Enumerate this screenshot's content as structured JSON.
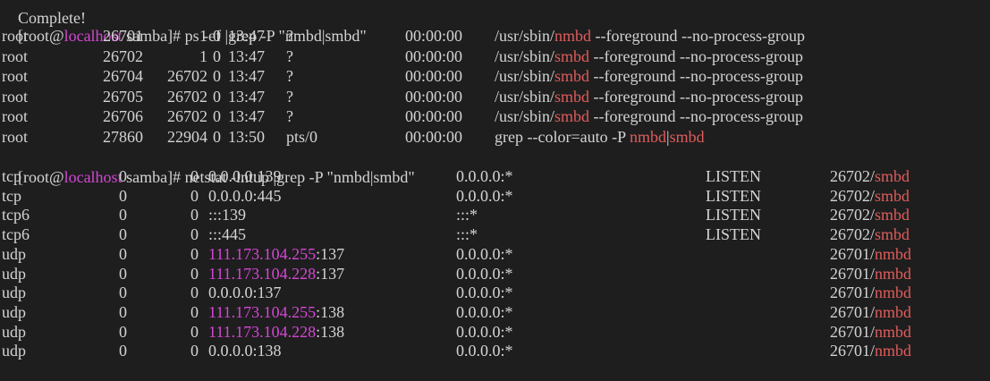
{
  "top_partial": "Complete!",
  "prompt": {
    "bracket_open": "[",
    "user": "root",
    "at": "@",
    "host": "localhost",
    "dir": " samba",
    "bracket_close": "]# "
  },
  "cmd1": {
    "pre": "ps -ef |grep -P \"nmbd|smbd\""
  },
  "ps_rows": [
    {
      "user": "root",
      "pid": "26701",
      "ppid": "1",
      "c": "0",
      "stime": "13:47",
      "tty": "?",
      "time": "00:00:00",
      "cmd_pre": "/usr/sbin/",
      "cmd_hl": "nmbd",
      "cmd_post": " --foreground --no-process-group"
    },
    {
      "user": "root",
      "pid": "26702",
      "ppid": "1",
      "c": "0",
      "stime": "13:47",
      "tty": "?",
      "time": "00:00:00",
      "cmd_pre": "/usr/sbin/",
      "cmd_hl": "smbd",
      "cmd_post": " --foreground --no-process-group"
    },
    {
      "user": "root",
      "pid": "26704",
      "ppid": "26702",
      "c": "0",
      "stime": "13:47",
      "tty": "?",
      "time": "00:00:00",
      "cmd_pre": "/usr/sbin/",
      "cmd_hl": "smbd",
      "cmd_post": " --foreground --no-process-group"
    },
    {
      "user": "root",
      "pid": "26705",
      "ppid": "26702",
      "c": "0",
      "stime": "13:47",
      "tty": "?",
      "time": "00:00:00",
      "cmd_pre": "/usr/sbin/",
      "cmd_hl": "smbd",
      "cmd_post": " --foreground --no-process-group"
    },
    {
      "user": "root",
      "pid": "26706",
      "ppid": "26702",
      "c": "0",
      "stime": "13:47",
      "tty": "?",
      "time": "00:00:00",
      "cmd_pre": "/usr/sbin/",
      "cmd_hl": "smbd",
      "cmd_post": " --foreground --no-process-group"
    },
    {
      "user": "root",
      "pid": "27860",
      "ppid": "22904",
      "c": "0",
      "stime": "13:50",
      "tty": "pts/0",
      "time": "00:00:00",
      "cmd_pre": "grep --color=auto -P ",
      "cmd_hl": "nmbd",
      "cmd_mid": "|",
      "cmd_hl2": "smbd",
      "cmd_post": ""
    }
  ],
  "cmd2": {
    "pre": "netstat -lntup |grep -P \"nmbd|smbd\""
  },
  "netstat_rows": [
    {
      "proto": "tcp",
      "recvq": "0",
      "sendq": "0",
      "local_pre": "0.0.0.0:139",
      "local_hl": "",
      "local_post": "",
      "foreign": "0.0.0.0:*",
      "state": "LISTEN",
      "pid": "26702/",
      "prog": "smbd"
    },
    {
      "proto": "tcp",
      "recvq": "0",
      "sendq": "0",
      "local_pre": "0.0.0.0:445",
      "local_hl": "",
      "local_post": "",
      "foreign": "0.0.0.0:*",
      "state": "LISTEN",
      "pid": "26702/",
      "prog": "smbd"
    },
    {
      "proto": "tcp6",
      "recvq": "0",
      "sendq": "0",
      "local_pre": ":::139",
      "local_hl": "",
      "local_post": "",
      "foreign": ":::*",
      "state": "LISTEN",
      "pid": "26702/",
      "prog": "smbd"
    },
    {
      "proto": "tcp6",
      "recvq": "0",
      "sendq": "0",
      "local_pre": ":::445",
      "local_hl": "",
      "local_post": "",
      "foreign": ":::*",
      "state": "LISTEN",
      "pid": "26702/",
      "prog": "smbd"
    },
    {
      "proto": "udp",
      "recvq": "0",
      "sendq": "0",
      "local_pre": "",
      "local_hl": "111.173.104.255",
      "local_post": ":137",
      "foreign": "0.0.0.0:*",
      "state": "",
      "pid": "26701/",
      "prog": "nmbd"
    },
    {
      "proto": "udp",
      "recvq": "0",
      "sendq": "0",
      "local_pre": "",
      "local_hl": "111.173.104.228",
      "local_post": ":137",
      "foreign": "0.0.0.0:*",
      "state": "",
      "pid": "26701/",
      "prog": "nmbd"
    },
    {
      "proto": "udp",
      "recvq": "0",
      "sendq": "0",
      "local_pre": "0.0.0.0:137",
      "local_hl": "",
      "local_post": "",
      "foreign": "0.0.0.0:*",
      "state": "",
      "pid": "26701/",
      "prog": "nmbd"
    },
    {
      "proto": "udp",
      "recvq": "0",
      "sendq": "0",
      "local_pre": "",
      "local_hl": "111.173.104.255",
      "local_post": ":138",
      "foreign": "0.0.0.0:*",
      "state": "",
      "pid": "26701/",
      "prog": "nmbd"
    },
    {
      "proto": "udp",
      "recvq": "0",
      "sendq": "0",
      "local_pre": "",
      "local_hl": "111.173.104.228",
      "local_post": ":138",
      "foreign": "0.0.0.0:*",
      "state": "",
      "pid": "26701/",
      "prog": "nmbd"
    },
    {
      "proto": "udp",
      "recvq": "0",
      "sendq": "0",
      "local_pre": "0.0.0.0:138",
      "local_hl": "",
      "local_post": "",
      "foreign": "0.0.0.0:*",
      "state": "",
      "pid": "26701/",
      "prog": "nmbd"
    }
  ],
  "colors": {
    "background": "#1e1e1e",
    "foreground": "#d4d4d4",
    "hostname": "#d447d4",
    "match_highlight": "#e05c5c",
    "ip_highlight": "#d447d4"
  }
}
